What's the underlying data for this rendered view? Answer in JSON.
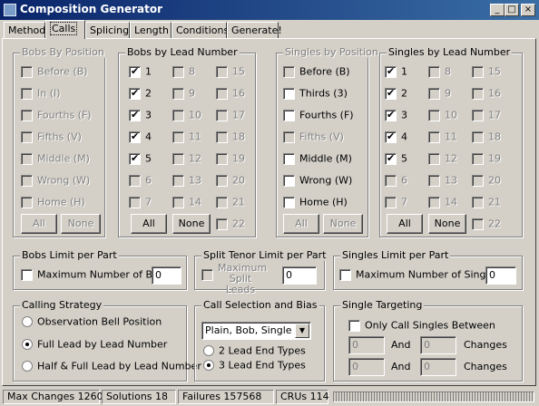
{
  "window": {
    "title": "Composition Generator",
    "tabs": [
      {
        "label": "Method",
        "active": false
      },
      {
        "label": "Calls",
        "active": true
      },
      {
        "label": "Splicing",
        "active": false
      },
      {
        "label": "Length",
        "active": false
      },
      {
        "label": "Conditions",
        "active": false
      },
      {
        "label": "Generate!",
        "active": false
      }
    ],
    "controls": {
      "minimize": "_",
      "maximize": "□",
      "close": "×"
    }
  },
  "bobs_by_position": {
    "title": "Bobs By Position",
    "enabled": false,
    "items": [
      {
        "label": "Before (B)",
        "checked": false
      },
      {
        "label": "In (I)",
        "checked": false
      },
      {
        "label": "Fourths (F)",
        "checked": false
      },
      {
        "label": "Fifths (V)",
        "checked": false
      },
      {
        "label": "Middle (M)",
        "checked": false
      },
      {
        "label": "Wrong (W)",
        "checked": false
      },
      {
        "label": "Home (H)",
        "checked": false
      }
    ],
    "all_label": "All",
    "none_label": "None"
  },
  "bobs_by_lead": {
    "title": "Bobs by Lead Number",
    "col1": [
      "1",
      "2",
      "3",
      "4",
      "5",
      "6",
      "7"
    ],
    "col2": [
      "8",
      "9",
      "10",
      "11",
      "12",
      "13",
      "14"
    ],
    "col3": [
      "15",
      "16",
      "17",
      "18",
      "19",
      "20",
      "21",
      "22"
    ],
    "all_label": "All",
    "none_label": "None"
  },
  "singles_by_position": {
    "title": "Singles by Position",
    "items": [
      {
        "label": "Before (B)"
      },
      {
        "label": "Thirds (3)"
      },
      {
        "label": "Fourths (F)"
      },
      {
        "label": "Fifths (V)"
      },
      {
        "label": "Middle (M)"
      },
      {
        "label": "Wrong (W)"
      },
      {
        "label": "Home (H)"
      }
    ],
    "all_label": "All",
    "none_label": "None"
  },
  "singles_by_lead": {
    "title": "Singles by Lead Number",
    "col1": [
      "1",
      "2",
      "3",
      "4",
      "5",
      "6",
      "7"
    ],
    "col2": [
      "8",
      "9",
      "10",
      "11",
      "12",
      "13",
      "14"
    ],
    "col3": [
      "15",
      "16",
      "17",
      "18",
      "19",
      "20",
      "21",
      "22"
    ],
    "all_label": "All",
    "none_label": "None"
  },
  "bobs_limit": {
    "title": "Bobs Limit per Part",
    "label": "Maximum Number of Bobs",
    "value": "0"
  },
  "split_tenor": {
    "title": "Split Tenor Limit per Part",
    "label_line1": "Maximum",
    "label_line2": "Split Leads",
    "value": "0"
  },
  "singles_limit": {
    "title": "Singles Limit per Part",
    "label": "Maximum Number of Singles",
    "value": "0"
  },
  "calling_strategy": {
    "title": "Calling Strategy",
    "options": [
      "Observation Bell Position",
      "Full Lead by Lead Number",
      "Half & Full Lead by Lead Number"
    ],
    "selected": 1
  },
  "call_selection": {
    "title": "Call Selection and Bias",
    "dropdown_value": "Plain, Bob, Single",
    "options": [
      "2 Lead End Types",
      "3 Lead End Types"
    ],
    "selected": 1
  },
  "single_targeting": {
    "title": "Single Targeting",
    "checkbox_label": "Only Call Singles Between",
    "and_label": "And",
    "changes_label": "Changes",
    "row1": [
      "0",
      "0"
    ],
    "row2": [
      "0",
      "0"
    ]
  },
  "status": {
    "max_changes": "Max Changes 1260",
    "solutions": "Solutions 18",
    "failures": "Failures 157568",
    "crus": "CRUs 114"
  }
}
